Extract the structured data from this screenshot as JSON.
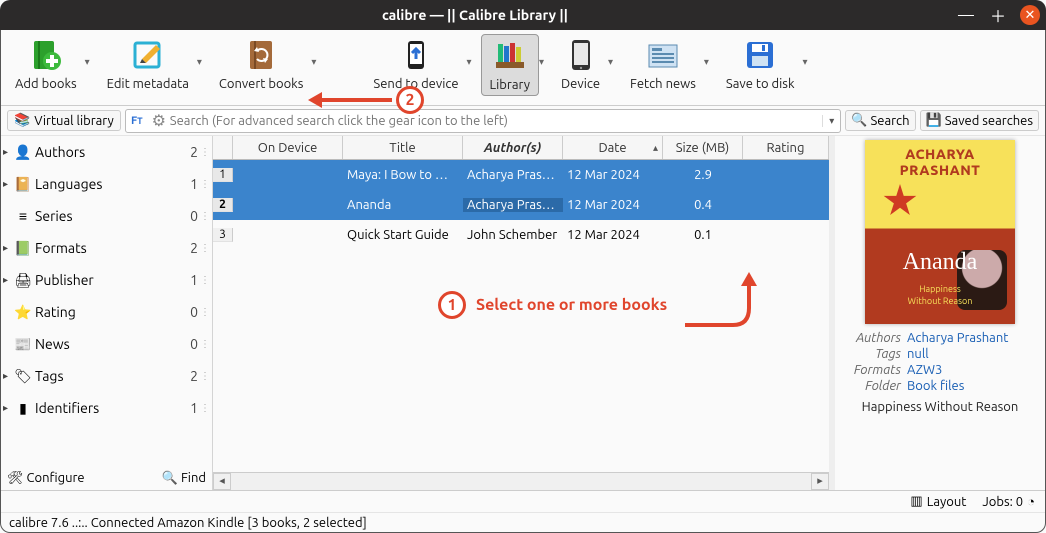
{
  "window": {
    "title": "calibre — || Calibre Library ||"
  },
  "toolbar": {
    "add": {
      "label": "Add books"
    },
    "edit": {
      "label": "Edit metadata"
    },
    "convert": {
      "label": "Convert books"
    },
    "send": {
      "label": "Send to device"
    },
    "library": {
      "label": "Library"
    },
    "device": {
      "label": "Device"
    },
    "news": {
      "label": "Fetch news"
    },
    "save": {
      "label": "Save to disk"
    }
  },
  "searchrow": {
    "virtual_library": "Virtual library",
    "search_placeholder": "Search (For advanced search click the gear icon to the left)",
    "search_btn": "Search",
    "saved_searches": "Saved searches"
  },
  "categories": [
    {
      "name": "Authors",
      "count": "2",
      "icon": "authors",
      "expandable": true
    },
    {
      "name": "Languages",
      "count": "1",
      "icon": "languages",
      "expandable": true
    },
    {
      "name": "Series",
      "count": "0",
      "icon": "series",
      "expandable": false
    },
    {
      "name": "Formats",
      "count": "2",
      "icon": "formats",
      "expandable": true
    },
    {
      "name": "Publisher",
      "count": "1",
      "icon": "publisher",
      "expandable": true
    },
    {
      "name": "Rating",
      "count": "0",
      "icon": "rating",
      "expandable": false
    },
    {
      "name": "News",
      "count": "0",
      "icon": "news",
      "expandable": false
    },
    {
      "name": "Tags",
      "count": "2",
      "icon": "tags",
      "expandable": true
    },
    {
      "name": "Identifiers",
      "count": "1",
      "icon": "identifiers",
      "expandable": true
    }
  ],
  "footer_left": {
    "configure": "Configure",
    "find": "Find"
  },
  "grid": {
    "headers": {
      "on_device": "On Device",
      "title": "Title",
      "authors": "Author(s)",
      "date": "Date",
      "size": "Size (MB)",
      "rating": "Rating"
    },
    "rows": [
      {
        "n": "1",
        "title": "Maya: I Bow to …",
        "author": "Acharya Pras…",
        "date": "12 Mar 2024",
        "size": "2.9",
        "selected": true,
        "focus_col": ""
      },
      {
        "n": "2",
        "title": "Ananda",
        "author": "Acharya Pras…",
        "date": "12 Mar 2024",
        "size": "0.4",
        "selected": true,
        "focus_col": "author"
      },
      {
        "n": "3",
        "title": "Quick Start Guide",
        "author": "John Schember",
        "date": "12 Mar 2024",
        "size": "0.1",
        "selected": false,
        "focus_col": ""
      }
    ]
  },
  "annotations": {
    "step1": "Select one or more books",
    "step1_n": "1",
    "step2_n": "2"
  },
  "details": {
    "cover": {
      "line1": "ACHARYA",
      "line2": "PRASHANT",
      "big": "Ananda",
      "sub1": "Happiness",
      "sub2": "Without Reason"
    },
    "meta": {
      "authors_k": "Authors",
      "authors_v": "Acharya Prashant",
      "tags_k": "Tags",
      "tags_v": "null",
      "formats_k": "Formats",
      "formats_v": "AZW3",
      "folder_k": "Folder",
      "folder_v": "Book files"
    },
    "tagline": "Happiness Without Reason"
  },
  "statusbar": {
    "layout": "Layout",
    "jobs": "Jobs: 0",
    "line": "calibre 7.6 ..:.. Connected Amazon Kindle    [3 books, 2 selected]"
  }
}
